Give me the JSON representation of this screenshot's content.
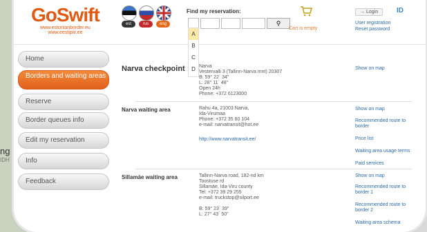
{
  "background_map": {
    "lines": [
      "ng",
      "IDH"
    ]
  },
  "header": {
    "logo_text": "GoSwift",
    "logo_sub": [
      "www.estonianborder.eu",
      "www.eestipiir.ee"
    ],
    "flags": [
      {
        "code": "est",
        "color": "#333333"
      },
      {
        "code": "rus",
        "color": "#c22a2a"
      },
      {
        "code": "eng",
        "color": "#e46a1a"
      }
    ],
    "find_label": "Find my reservation:",
    "dropdown_items": [
      "A",
      "B",
      "C",
      "D"
    ],
    "dropdown_selected": "A",
    "cart_text": "Cart is empty",
    "login_label": "Login",
    "user_registration": "User registration",
    "reset_password": "Reset password",
    "id_text": "ID"
  },
  "sidebar": {
    "items": [
      {
        "label": "Home",
        "active": false
      },
      {
        "label": "Borders and waiting areas",
        "active": true
      },
      {
        "label": "Reserve",
        "active": false
      },
      {
        "label": "Border queues info",
        "active": false
      },
      {
        "label": "Edit my reservation",
        "active": false
      },
      {
        "label": "Info",
        "active": false
      },
      {
        "label": "Feedback",
        "active": false
      }
    ]
  },
  "sections": [
    {
      "title": "Narva checkpoint",
      "lines": "Narva\nVestervalli 3 (Tallinn-Narva mnt) 20307\nB: 59° 22´ 34\"\nL: 28° 11´ 48\"\nOpen 24h\nPhone: +372 6123000",
      "links": [
        "Show on map"
      ]
    },
    {
      "title": "Narva waiting area",
      "lines": "Rahu 4a, 21003 Narva,\nIda-Virumaa\nPhone: +372 35 60 104\ne-mail: narvatransit@hot.ee",
      "url": "http://www.narvatransit.ee/",
      "links": [
        "Show on map",
        "Recommended route to border",
        "Price list",
        "Waiting area usage terms",
        "Paid services"
      ]
    },
    {
      "title": "Sillamäe waiting area",
      "lines": "Tallinn-Narva road, 182-nd km\nToostuse rd\nSillamäe, Ida-Viru county\nTel: +372 39 29 255\ne-mail: truckstop@silport.ee\n\nB: 59° 23´ 39\"\nL: 27° 43´ 50\"",
      "links": [
        "Show on map",
        "Recommended route to border 1",
        "Recommended route to border 2",
        "Waiting area schema"
      ]
    }
  ]
}
